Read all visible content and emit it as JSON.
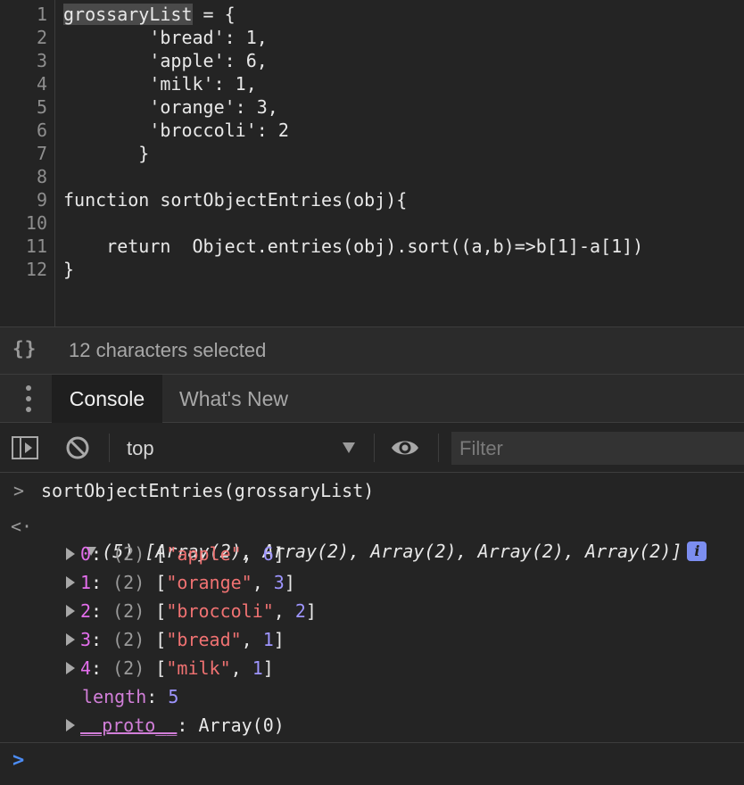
{
  "editor": {
    "line_numbers": [
      "1",
      "2",
      "3",
      "4",
      "5",
      "6",
      "7",
      "8",
      "9",
      "10",
      "11",
      "12"
    ],
    "lines": [
      {
        "selected": "grossaryList",
        "rest": " = {"
      },
      {
        "text": "        'bread': 1,"
      },
      {
        "text": "        'apple': 6,"
      },
      {
        "text": "        'milk': 1,"
      },
      {
        "text": "        'orange': 3,"
      },
      {
        "text": "        'broccoli': 2"
      },
      {
        "text": "       }"
      },
      {
        "text": ""
      },
      {
        "text": "function sortObjectEntries(obj){"
      },
      {
        "text": ""
      },
      {
        "text": "    return  Object.entries(obj).sort((a,b)=>b[1]-a[1])"
      },
      {
        "text": "}"
      }
    ]
  },
  "status": {
    "braces_icon": "{}",
    "selection_text": "12 characters selected"
  },
  "drawer": {
    "menu_icon": "kebab-menu-icon",
    "tabs": [
      {
        "label": "Console",
        "active": true
      },
      {
        "label": "What's New",
        "active": false
      }
    ]
  },
  "toolbar": {
    "sidebar_icon": "sidebar-toggle-icon",
    "clear_icon": "clear-console-icon",
    "context_value": "top",
    "eye_icon": "live-expression-eye-icon",
    "filter_placeholder": "Filter"
  },
  "console": {
    "input_command": "sortObjectEntries(grossaryList)",
    "result": {
      "summary_count": "(5)",
      "summary_text": "[Array(2), Array(2), Array(2), Array(2), Array(2)]",
      "info_badge": "i",
      "entries": [
        {
          "index": "0",
          "count": "(2)",
          "key": "\"apple\"",
          "value": "6"
        },
        {
          "index": "1",
          "count": "(2)",
          "key": "\"orange\"",
          "value": "3"
        },
        {
          "index": "2",
          "count": "(2)",
          "key": "\"broccoli\"",
          "value": "2"
        },
        {
          "index": "3",
          "count": "(2)",
          "key": "\"bread\"",
          "value": "1"
        },
        {
          "index": "4",
          "count": "(2)",
          "key": "\"milk\"",
          "value": "1"
        }
      ],
      "length_label": "length",
      "length_value": "5",
      "proto_label": "__proto__",
      "proto_value": "Array(0)"
    },
    "prompt_symbol": ">",
    "result_symbol": "<·"
  },
  "colors": {
    "background": "#242424",
    "string": "#f07272",
    "number": "#9e95ff",
    "index": "#e36eec",
    "prompt": "#4c8df6"
  }
}
